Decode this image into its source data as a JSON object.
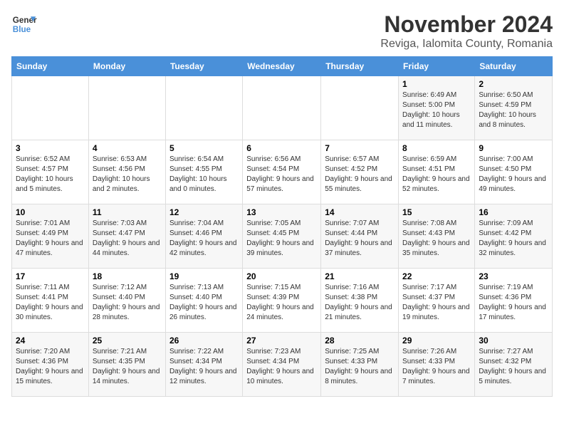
{
  "logo": {
    "line1": "General",
    "line2": "Blue"
  },
  "title": "November 2024",
  "location": "Reviga, Ialomita County, Romania",
  "headers": [
    "Sunday",
    "Monday",
    "Tuesday",
    "Wednesday",
    "Thursday",
    "Friday",
    "Saturday"
  ],
  "weeks": [
    [
      {
        "day": "",
        "info": ""
      },
      {
        "day": "",
        "info": ""
      },
      {
        "day": "",
        "info": ""
      },
      {
        "day": "",
        "info": ""
      },
      {
        "day": "",
        "info": ""
      },
      {
        "day": "1",
        "info": "Sunrise: 6:49 AM\nSunset: 5:00 PM\nDaylight: 10 hours and 11 minutes."
      },
      {
        "day": "2",
        "info": "Sunrise: 6:50 AM\nSunset: 4:59 PM\nDaylight: 10 hours and 8 minutes."
      }
    ],
    [
      {
        "day": "3",
        "info": "Sunrise: 6:52 AM\nSunset: 4:57 PM\nDaylight: 10 hours and 5 minutes."
      },
      {
        "day": "4",
        "info": "Sunrise: 6:53 AM\nSunset: 4:56 PM\nDaylight: 10 hours and 2 minutes."
      },
      {
        "day": "5",
        "info": "Sunrise: 6:54 AM\nSunset: 4:55 PM\nDaylight: 10 hours and 0 minutes."
      },
      {
        "day": "6",
        "info": "Sunrise: 6:56 AM\nSunset: 4:54 PM\nDaylight: 9 hours and 57 minutes."
      },
      {
        "day": "7",
        "info": "Sunrise: 6:57 AM\nSunset: 4:52 PM\nDaylight: 9 hours and 55 minutes."
      },
      {
        "day": "8",
        "info": "Sunrise: 6:59 AM\nSunset: 4:51 PM\nDaylight: 9 hours and 52 minutes."
      },
      {
        "day": "9",
        "info": "Sunrise: 7:00 AM\nSunset: 4:50 PM\nDaylight: 9 hours and 49 minutes."
      }
    ],
    [
      {
        "day": "10",
        "info": "Sunrise: 7:01 AM\nSunset: 4:49 PM\nDaylight: 9 hours and 47 minutes."
      },
      {
        "day": "11",
        "info": "Sunrise: 7:03 AM\nSunset: 4:47 PM\nDaylight: 9 hours and 44 minutes."
      },
      {
        "day": "12",
        "info": "Sunrise: 7:04 AM\nSunset: 4:46 PM\nDaylight: 9 hours and 42 minutes."
      },
      {
        "day": "13",
        "info": "Sunrise: 7:05 AM\nSunset: 4:45 PM\nDaylight: 9 hours and 39 minutes."
      },
      {
        "day": "14",
        "info": "Sunrise: 7:07 AM\nSunset: 4:44 PM\nDaylight: 9 hours and 37 minutes."
      },
      {
        "day": "15",
        "info": "Sunrise: 7:08 AM\nSunset: 4:43 PM\nDaylight: 9 hours and 35 minutes."
      },
      {
        "day": "16",
        "info": "Sunrise: 7:09 AM\nSunset: 4:42 PM\nDaylight: 9 hours and 32 minutes."
      }
    ],
    [
      {
        "day": "17",
        "info": "Sunrise: 7:11 AM\nSunset: 4:41 PM\nDaylight: 9 hours and 30 minutes."
      },
      {
        "day": "18",
        "info": "Sunrise: 7:12 AM\nSunset: 4:40 PM\nDaylight: 9 hours and 28 minutes."
      },
      {
        "day": "19",
        "info": "Sunrise: 7:13 AM\nSunset: 4:40 PM\nDaylight: 9 hours and 26 minutes."
      },
      {
        "day": "20",
        "info": "Sunrise: 7:15 AM\nSunset: 4:39 PM\nDaylight: 9 hours and 24 minutes."
      },
      {
        "day": "21",
        "info": "Sunrise: 7:16 AM\nSunset: 4:38 PM\nDaylight: 9 hours and 21 minutes."
      },
      {
        "day": "22",
        "info": "Sunrise: 7:17 AM\nSunset: 4:37 PM\nDaylight: 9 hours and 19 minutes."
      },
      {
        "day": "23",
        "info": "Sunrise: 7:19 AM\nSunset: 4:36 PM\nDaylight: 9 hours and 17 minutes."
      }
    ],
    [
      {
        "day": "24",
        "info": "Sunrise: 7:20 AM\nSunset: 4:36 PM\nDaylight: 9 hours and 15 minutes."
      },
      {
        "day": "25",
        "info": "Sunrise: 7:21 AM\nSunset: 4:35 PM\nDaylight: 9 hours and 14 minutes."
      },
      {
        "day": "26",
        "info": "Sunrise: 7:22 AM\nSunset: 4:34 PM\nDaylight: 9 hours and 12 minutes."
      },
      {
        "day": "27",
        "info": "Sunrise: 7:23 AM\nSunset: 4:34 PM\nDaylight: 9 hours and 10 minutes."
      },
      {
        "day": "28",
        "info": "Sunrise: 7:25 AM\nSunset: 4:33 PM\nDaylight: 9 hours and 8 minutes."
      },
      {
        "day": "29",
        "info": "Sunrise: 7:26 AM\nSunset: 4:33 PM\nDaylight: 9 hours and 7 minutes."
      },
      {
        "day": "30",
        "info": "Sunrise: 7:27 AM\nSunset: 4:32 PM\nDaylight: 9 hours and 5 minutes."
      }
    ]
  ]
}
